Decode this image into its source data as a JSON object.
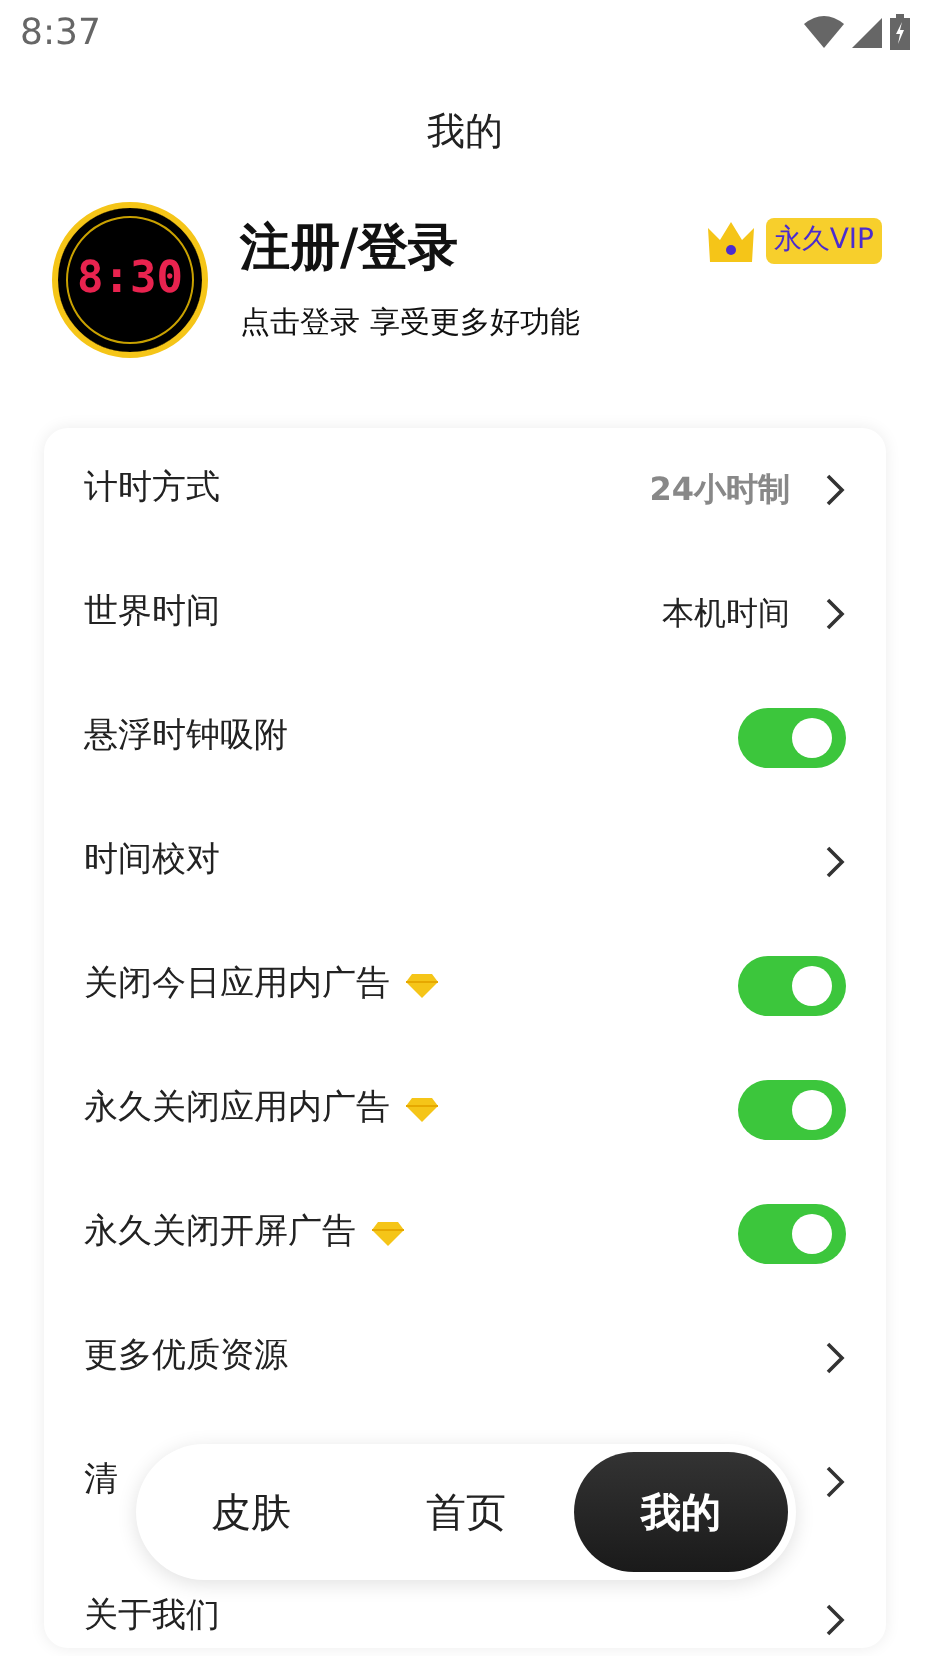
{
  "status_bar": {
    "time": "8:37"
  },
  "title": "我的",
  "profile": {
    "avatar_clock": "8:30",
    "name": "注册/登录",
    "subtitle": "点击登录 享受更多好功能",
    "vip_badge": "永久VIP"
  },
  "settings": [
    {
      "kind": "value",
      "label": "计时方式",
      "value": "24小时制",
      "muted": true
    },
    {
      "kind": "value",
      "label": "世界时间",
      "value": "本机时间",
      "muted": false
    },
    {
      "kind": "toggle",
      "label": "悬浮时钟吸附",
      "on": true,
      "vip": false
    },
    {
      "kind": "link",
      "label": "时间校对"
    },
    {
      "kind": "toggle",
      "label": "关闭今日应用内广告",
      "on": true,
      "vip": true
    },
    {
      "kind": "toggle",
      "label": "永久关闭应用内广告",
      "on": true,
      "vip": true
    },
    {
      "kind": "toggle",
      "label": "永久关闭开屏广告",
      "on": true,
      "vip": true
    },
    {
      "kind": "link",
      "label": "更多优质资源"
    },
    {
      "kind": "link",
      "label": "清"
    },
    {
      "kind": "link",
      "label": "关于我们"
    }
  ],
  "bottom_nav": [
    {
      "label": "皮肤",
      "selected": false
    },
    {
      "label": "首页",
      "selected": false
    },
    {
      "label": "我的",
      "selected": true
    }
  ]
}
